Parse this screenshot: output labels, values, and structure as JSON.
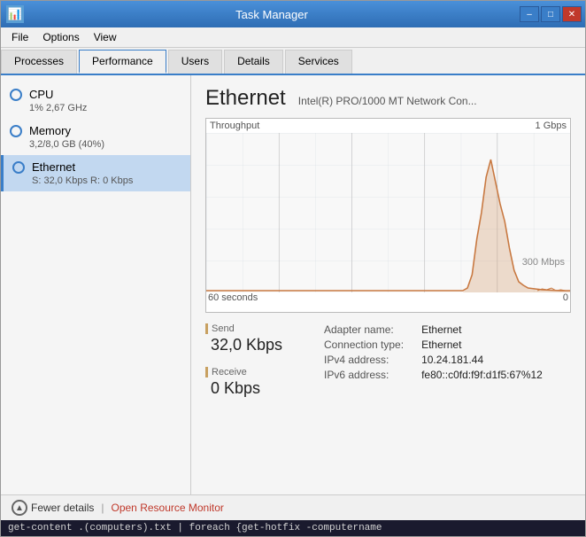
{
  "window": {
    "title": "Task Manager",
    "icon": "📊"
  },
  "title_controls": {
    "minimize": "–",
    "maximize": "□",
    "close": "✕"
  },
  "menu": {
    "items": [
      "File",
      "Options",
      "View"
    ]
  },
  "tabs": [
    {
      "label": "Processes",
      "active": false
    },
    {
      "label": "Performance",
      "active": true
    },
    {
      "label": "Users",
      "active": false
    },
    {
      "label": "Details",
      "active": false
    },
    {
      "label": "Services",
      "active": false
    }
  ],
  "sidebar": {
    "items": [
      {
        "label": "CPU",
        "sublabel": "1% 2,67 GHz",
        "active": false
      },
      {
        "label": "Memory",
        "sublabel": "3,2/8,0 GB (40%)",
        "active": false
      },
      {
        "label": "Ethernet",
        "sublabel": "S: 32,0 Kbps  R: 0 Kbps",
        "active": true
      }
    ]
  },
  "detail": {
    "title": "Ethernet",
    "subtitle": "Intel(R) PRO/1000 MT Network Con...",
    "chart": {
      "throughput_label": "Throughput",
      "max_label": "1 Gbps",
      "mid_label": "300 Mbps",
      "time_start": "60 seconds",
      "time_end": "0"
    },
    "send": {
      "label": "Send",
      "value": "32,0 Kbps"
    },
    "receive": {
      "label": "Receive",
      "value": "0 Kbps"
    },
    "adapter": {
      "name_label": "Adapter name:",
      "name_value": "Ethernet",
      "conn_label": "Connection type:",
      "conn_value": "Ethernet",
      "ipv4_label": "IPv4 address:",
      "ipv4_value": "10.24.181.44",
      "ipv6_label": "IPv6 address:",
      "ipv6_value": "fe80::c0fd:f9f:d1f5:67%12"
    }
  },
  "bottom": {
    "fewer_details": "Fewer details",
    "separator": "|",
    "open_resource": "Open Resource Monitor"
  },
  "terminal": {
    "text": "get-content .(computers).txt | foreach {get-hotfix -computername"
  }
}
